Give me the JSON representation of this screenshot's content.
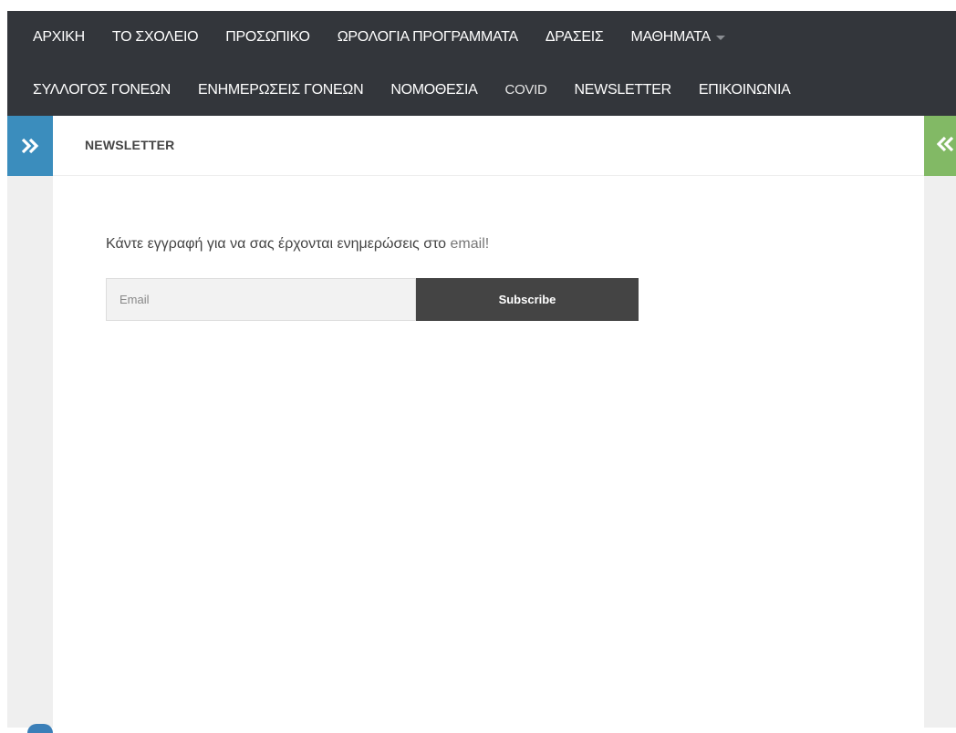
{
  "nav": {
    "row1": [
      {
        "label": "ΑΡΧΙΚΗ"
      },
      {
        "label": "ΤΟ ΣΧΟΛΕΙΟ"
      },
      {
        "label": "ΠΡΟΣΩΠΙΚΟ"
      },
      {
        "label": "ΩΡΟΛΟΓΙΑ ΠΡΟΓΡΑΜΜΑΤΑ"
      },
      {
        "label": "ΔΡΑΣΕΙΣ"
      },
      {
        "label": "ΜΑΘΗΜΑΤΑ"
      }
    ],
    "row2": [
      {
        "label": "ΣΥΛΛΟΓΟΣ ΓΟΝΕΩΝ"
      },
      {
        "label": "ΕΝΗΜΕΡΩΣΕΙΣ ΓΟΝΕΩΝ"
      },
      {
        "label": "ΝΟΜΟΘΕΣΙΑ"
      },
      {
        "label": "COVID"
      },
      {
        "label": "NEWSLETTER"
      },
      {
        "label": "ΕΠΙΚΟΙΝΩΝΙΑ"
      }
    ]
  },
  "page": {
    "title": "NEWSLETTER",
    "intro_text": "Κάντε εγγραφή για να σας έρχονται ενημερώσεις στο",
    "intro_email_word": "email!"
  },
  "form": {
    "email_placeholder": "Email",
    "email_value": "",
    "subscribe_label": "Subscribe"
  },
  "icons": {
    "left_toggle": "double-chevron-right-icon",
    "right_toggle": "double-chevron-left-icon",
    "menu_dropdown": "caret-down-icon"
  },
  "colors": {
    "nav_bg": "#33363b",
    "left_toggle_bg": "#3b8dbd",
    "right_toggle_bg": "#82b965",
    "subscribe_bg": "#444444"
  }
}
